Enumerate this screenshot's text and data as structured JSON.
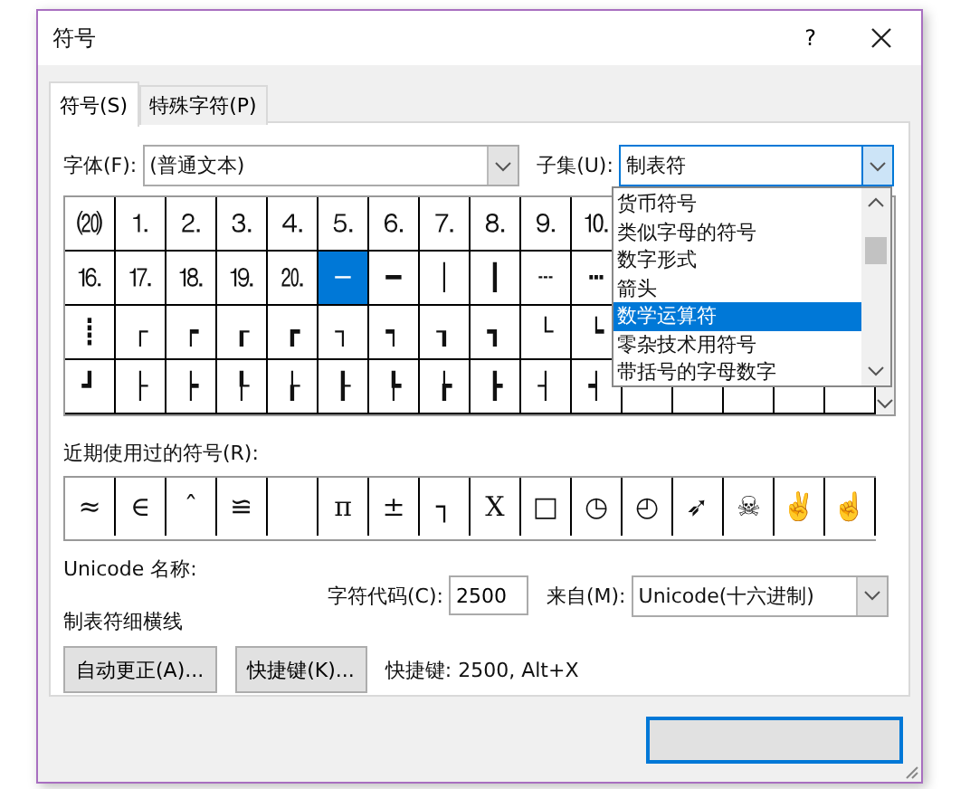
{
  "window": {
    "title": "符号",
    "help": "?"
  },
  "tabs": [
    {
      "label": "符号(S)",
      "selected": true
    },
    {
      "label": "特殊字符(P)",
      "selected": false
    }
  ],
  "font": {
    "label": "字体(F):",
    "value": "(普通文本)"
  },
  "subset": {
    "label": "子集(U):",
    "value": "制表符",
    "open": true,
    "options": [
      {
        "label": "货币符号",
        "selected": false
      },
      {
        "label": "类似字母的符号",
        "selected": false
      },
      {
        "label": "数字形式",
        "selected": false
      },
      {
        "label": "箭头",
        "selected": false
      },
      {
        "label": "数学运算符",
        "selected": true
      },
      {
        "label": "零杂技术用符号",
        "selected": false
      },
      {
        "label": "带括号的字母数字",
        "selected": false
      }
    ]
  },
  "symbol_grid": [
    [
      {
        "symbol": "⒇",
        "selected": false
      },
      {
        "symbol": "⒈",
        "selected": false
      },
      {
        "symbol": "⒉",
        "selected": false
      },
      {
        "symbol": "⒊",
        "selected": false
      },
      {
        "symbol": "⒋",
        "selected": false
      },
      {
        "symbol": "⒌",
        "selected": false
      },
      {
        "symbol": "⒍",
        "selected": false
      },
      {
        "symbol": "⒎",
        "selected": false
      },
      {
        "symbol": "⒏",
        "selected": false
      },
      {
        "symbol": "⒐",
        "selected": false
      },
      {
        "symbol": "⒑",
        "selected": false
      }
    ],
    [
      {
        "symbol": "⒗",
        "selected": false
      },
      {
        "symbol": "⒘",
        "selected": false
      },
      {
        "symbol": "⒙",
        "selected": false
      },
      {
        "symbol": "⒚",
        "selected": false
      },
      {
        "symbol": "⒛",
        "selected": false
      },
      {
        "symbol": "─",
        "selected": true
      },
      {
        "symbol": "━",
        "selected": false
      },
      {
        "symbol": "│",
        "selected": false
      },
      {
        "symbol": "┃",
        "selected": false
      },
      {
        "symbol": "┄",
        "selected": false
      },
      {
        "symbol": "┅",
        "selected": false
      }
    ],
    [
      {
        "symbol": "┋",
        "selected": false
      },
      {
        "symbol": "┌",
        "selected": false
      },
      {
        "symbol": "┍",
        "selected": false
      },
      {
        "symbol": "┎",
        "selected": false
      },
      {
        "symbol": "┏",
        "selected": false
      },
      {
        "symbol": "┐",
        "selected": false
      },
      {
        "symbol": "┑",
        "selected": false
      },
      {
        "symbol": "┒",
        "selected": false
      },
      {
        "symbol": "┓",
        "selected": false
      },
      {
        "symbol": "└",
        "selected": false
      },
      {
        "symbol": "┕",
        "selected": false
      }
    ],
    [
      {
        "symbol": "┛",
        "selected": false
      },
      {
        "symbol": "├",
        "selected": false
      },
      {
        "symbol": "┝",
        "selected": false
      },
      {
        "symbol": "┞",
        "selected": false
      },
      {
        "symbol": "┟",
        "selected": false
      },
      {
        "symbol": "┠",
        "selected": false
      },
      {
        "symbol": "┡",
        "selected": false
      },
      {
        "symbol": "┢",
        "selected": false
      },
      {
        "symbol": "┣",
        "selected": false
      },
      {
        "symbol": "┤",
        "selected": false
      },
      {
        "symbol": "┥",
        "selected": false
      }
    ]
  ],
  "recent": {
    "label": "近期使用过的符号(R):",
    "symbols": [
      {
        "kind": "glyph",
        "symbol": "≈"
      },
      {
        "kind": "glyph",
        "symbol": "∈"
      },
      {
        "kind": "glyph",
        "symbol": "ˆ"
      },
      {
        "kind": "glyph",
        "symbol": "≌"
      },
      {
        "kind": "blank"
      },
      {
        "kind": "glyph",
        "symbol": "π"
      },
      {
        "kind": "glyph",
        "symbol": "±"
      },
      {
        "kind": "glyph",
        "symbol": "┐"
      },
      {
        "kind": "glyph",
        "symbol": "Χ"
      },
      {
        "kind": "glyph",
        "symbol": "□"
      },
      {
        "kind": "glyph",
        "symbol": "◷"
      },
      {
        "kind": "glyph",
        "symbol": "◴"
      },
      {
        "kind": "glyph",
        "symbol": "➶"
      },
      {
        "kind": "glyph",
        "symbol": "☠"
      },
      {
        "kind": "glyph",
        "symbol": "✌"
      },
      {
        "kind": "glyph",
        "symbol": "☝"
      }
    ]
  },
  "unicode_name": {
    "label": "Unicode 名称:",
    "value": "制表符细横线"
  },
  "char_code": {
    "label": "字符代码(C):",
    "value": "2500"
  },
  "from": {
    "label": "来自(M):",
    "value": "Unicode(十六进制)"
  },
  "buttons": [
    {
      "label": "自动更正(A)..."
    },
    {
      "label": "快捷键(K)..."
    }
  ],
  "shortcut_text": "快捷键: 2500, Alt+X"
}
